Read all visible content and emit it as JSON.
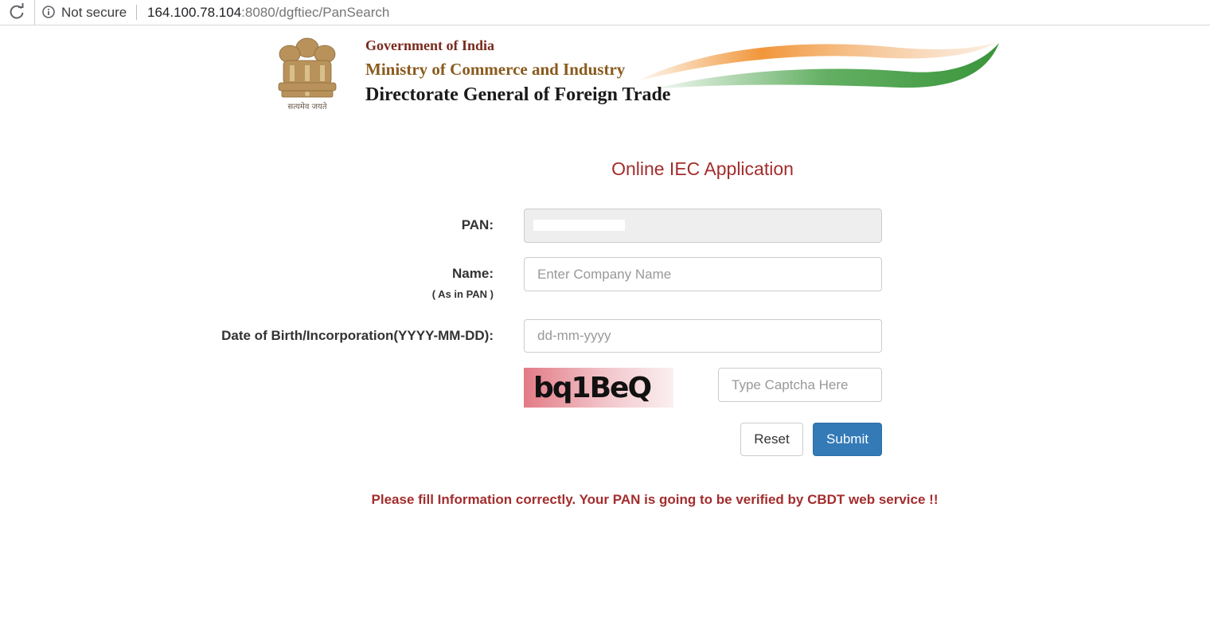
{
  "browser": {
    "security_label": "Not secure",
    "url_host": "164.100.78.104",
    "url_rest": ":8080/dgftiec/PanSearch"
  },
  "header": {
    "emblem_motto": "सत्यमेव जयते",
    "line1": "Government of India",
    "line2": "Ministry of Commerce and Industry",
    "line3": "Directorate General of Foreign Trade"
  },
  "form": {
    "title": "Online IEC Application",
    "pan_label": "PAN:",
    "pan_value": "",
    "name_label": "Name:",
    "name_sublabel": "( As in PAN )",
    "name_placeholder": "Enter Company Name",
    "dob_label": "Date of Birth/Incorporation(YYYY-MM-DD):",
    "dob_placeholder": "dd-mm-yyyy",
    "captcha_text": "bq1BeQ",
    "captcha_placeholder": "Type Captcha Here",
    "reset_label": "Reset",
    "submit_label": "Submit"
  },
  "notice": "Please fill Information correctly. Your PAN is going to be verified by CBDT web service !!",
  "colors": {
    "accent_red": "#a32d2d",
    "submit_blue": "#337ab7"
  }
}
